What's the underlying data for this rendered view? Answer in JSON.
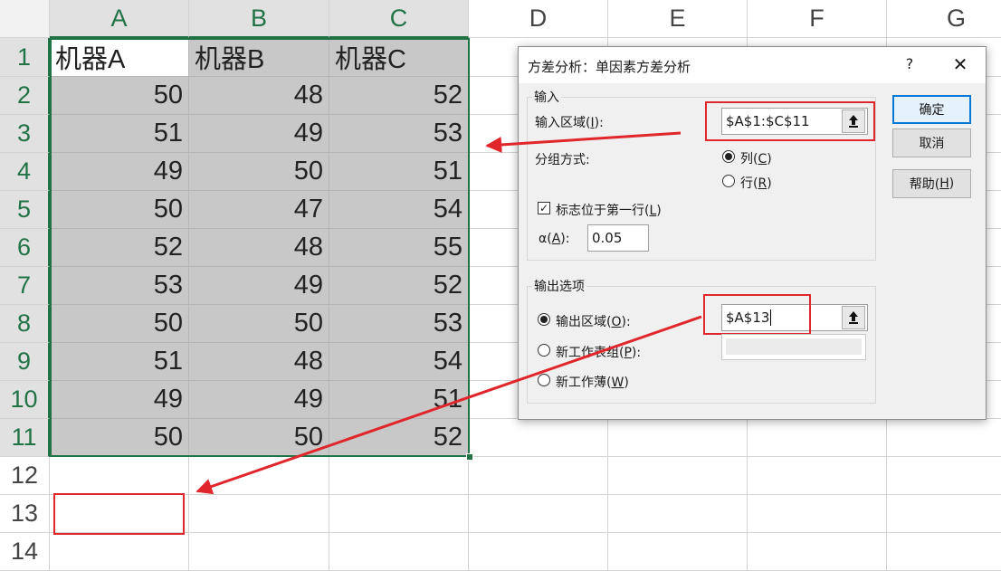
{
  "sheet": {
    "columns": [
      "A",
      "B",
      "C",
      "D",
      "E",
      "F",
      "G"
    ],
    "rows": [
      "1",
      "2",
      "3",
      "4",
      "5",
      "6",
      "7",
      "8",
      "9",
      "10",
      "11",
      "12",
      "13",
      "14"
    ],
    "headers": [
      "机器A",
      "机器B",
      "机器C"
    ],
    "data": [
      [
        50,
        48,
        52
      ],
      [
        51,
        49,
        53
      ],
      [
        49,
        50,
        51
      ],
      [
        50,
        47,
        54
      ],
      [
        52,
        48,
        55
      ],
      [
        53,
        49,
        52
      ],
      [
        50,
        50,
        53
      ],
      [
        51,
        48,
        54
      ],
      [
        49,
        49,
        51
      ],
      [
        50,
        50,
        52
      ]
    ],
    "selection_color": "#217346",
    "annotation_color": "#e0262b"
  },
  "dialog": {
    "title": "方差分析：单因素方差分析",
    "help_glyph": "?",
    "close_glyph": "✕",
    "input_group": "输入",
    "input_range_label": "输入区域(",
    "input_range_key": "I",
    "input_range_suffix": "):",
    "input_range_value": "$A$1:$C$11",
    "group_by_label": "分组方式:",
    "columns_label": "列(",
    "columns_key": "C",
    "rows_label": "行(",
    "rows_key": "R",
    "labels_first_row": "标志位于第一行(",
    "labels_key": "L",
    "alpha_label": "α(",
    "alpha_key": "A",
    "alpha_suffix": "):",
    "alpha_value": "0.05",
    "output_group": "输出选项",
    "output_range_label": "输出区域(",
    "output_range_key": "O",
    "output_range_suffix": "):",
    "output_range_value": "$A$13",
    "new_sheet_label": "新工作表组(",
    "new_sheet_key": "P",
    "new_sheet_suffix": "):",
    "new_workbook_label": "新工作薄(",
    "new_workbook_key": "W",
    "close_paren": ")",
    "ok": "确定",
    "cancel": "取消",
    "help": "帮助(",
    "help_key": "H",
    "group_by": "columns",
    "labels_checked": true,
    "output_option": "output_range"
  }
}
